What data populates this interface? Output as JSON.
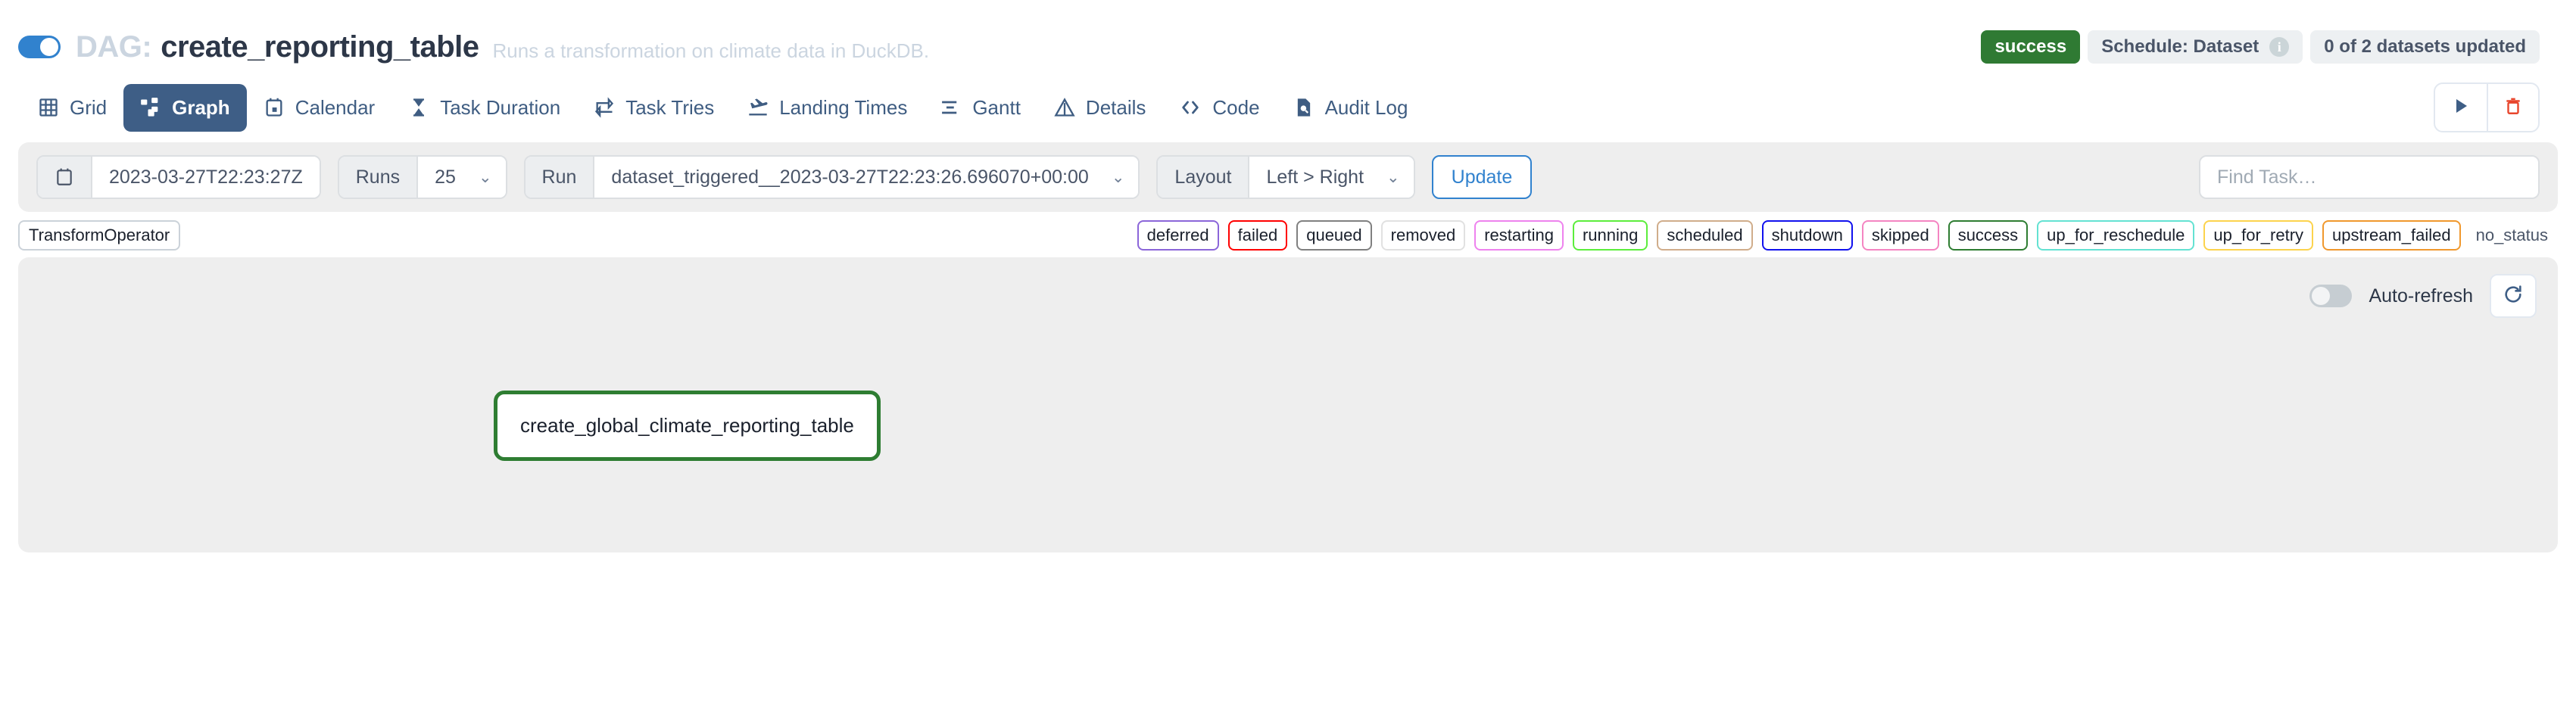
{
  "header": {
    "toggle_name": "dag-pause-toggle",
    "dag_label": "DAG:",
    "dag_title": "create_reporting_table",
    "description": "Runs a transformation on climate data in DuckDB.",
    "status_badge": "success",
    "schedule_badge": "Schedule: Dataset",
    "info_icon_glyph": "i",
    "datasets_badge": "0 of 2 datasets updated",
    "colors": {
      "toggle_on": "#3182ce",
      "success": "#2f7a33",
      "badge_gray": "#edf0f2"
    }
  },
  "nav": {
    "tabs": [
      {
        "label": "Grid",
        "icon": "grid-icon",
        "active": false
      },
      {
        "label": "Graph",
        "icon": "graph-icon",
        "active": true
      },
      {
        "label": "Calendar",
        "icon": "calendar-icon",
        "active": false
      },
      {
        "label": "Task Duration",
        "icon": "hourglass-icon",
        "active": false
      },
      {
        "label": "Task Tries",
        "icon": "retry-icon",
        "active": false
      },
      {
        "label": "Landing Times",
        "icon": "landing-plane-icon",
        "active": false
      },
      {
        "label": "Gantt",
        "icon": "gantt-icon",
        "active": false
      },
      {
        "label": "Details",
        "icon": "alert-triangle-icon",
        "active": false
      },
      {
        "label": "Code",
        "icon": "code-icon",
        "active": false
      },
      {
        "label": "Audit Log",
        "icon": "audit-log-icon",
        "active": false
      }
    ],
    "actions": [
      {
        "name": "trigger-dag-button",
        "icon": "play-icon",
        "color": "#3e5e86"
      },
      {
        "name": "delete-dag-button",
        "icon": "trash-icon",
        "color": "#e8452c"
      }
    ],
    "active_tab_bg": "#3e5e86"
  },
  "filters": {
    "calendar_icon": "calendar-icon",
    "date_value": "2023-03-27T22:23:27Z",
    "runs_label": "Runs",
    "runs_value": "25",
    "run_label": "Run",
    "run_value": "dataset_triggered__2023-03-27T22:23:26.696070+00:00",
    "layout_label": "Layout",
    "layout_value": "Left > Right",
    "update_label": "Update",
    "find_task_placeholder": "Find Task…",
    "find_task_value": "",
    "chevron_glyph": "⌄"
  },
  "legend": {
    "operator": "TransformOperator",
    "states": [
      {
        "label": "deferred",
        "color": "#8b66d9"
      },
      {
        "label": "failed",
        "color": "#ff0000"
      },
      {
        "label": "queued",
        "color": "#808080"
      },
      {
        "label": "removed",
        "color": "#e1e1e1"
      },
      {
        "label": "restarting",
        "color": "#ee82ee"
      },
      {
        "label": "running",
        "color": "#5ced3c"
      },
      {
        "label": "scheduled",
        "color": "#d0ad8b"
      },
      {
        "label": "shutdown",
        "color": "#1111ee"
      },
      {
        "label": "skipped",
        "color": "#f485c2"
      },
      {
        "label": "success",
        "color": "#2e7d32"
      },
      {
        "label": "up_for_reschedule",
        "color": "#64e2d2"
      },
      {
        "label": "up_for_retry",
        "color": "#fcd34d"
      },
      {
        "label": "upstream_failed",
        "color": "#f0982d"
      },
      {
        "label": "no_status",
        "color": "transparent"
      }
    ]
  },
  "graph": {
    "auto_refresh_label": "Auto-refresh",
    "auto_refresh_on": false,
    "refresh_icon": "refresh-icon",
    "nodes": [
      {
        "label": "create_global_climate_reporting_table",
        "state": "success",
        "border_color": "#2e7d32"
      }
    ]
  }
}
